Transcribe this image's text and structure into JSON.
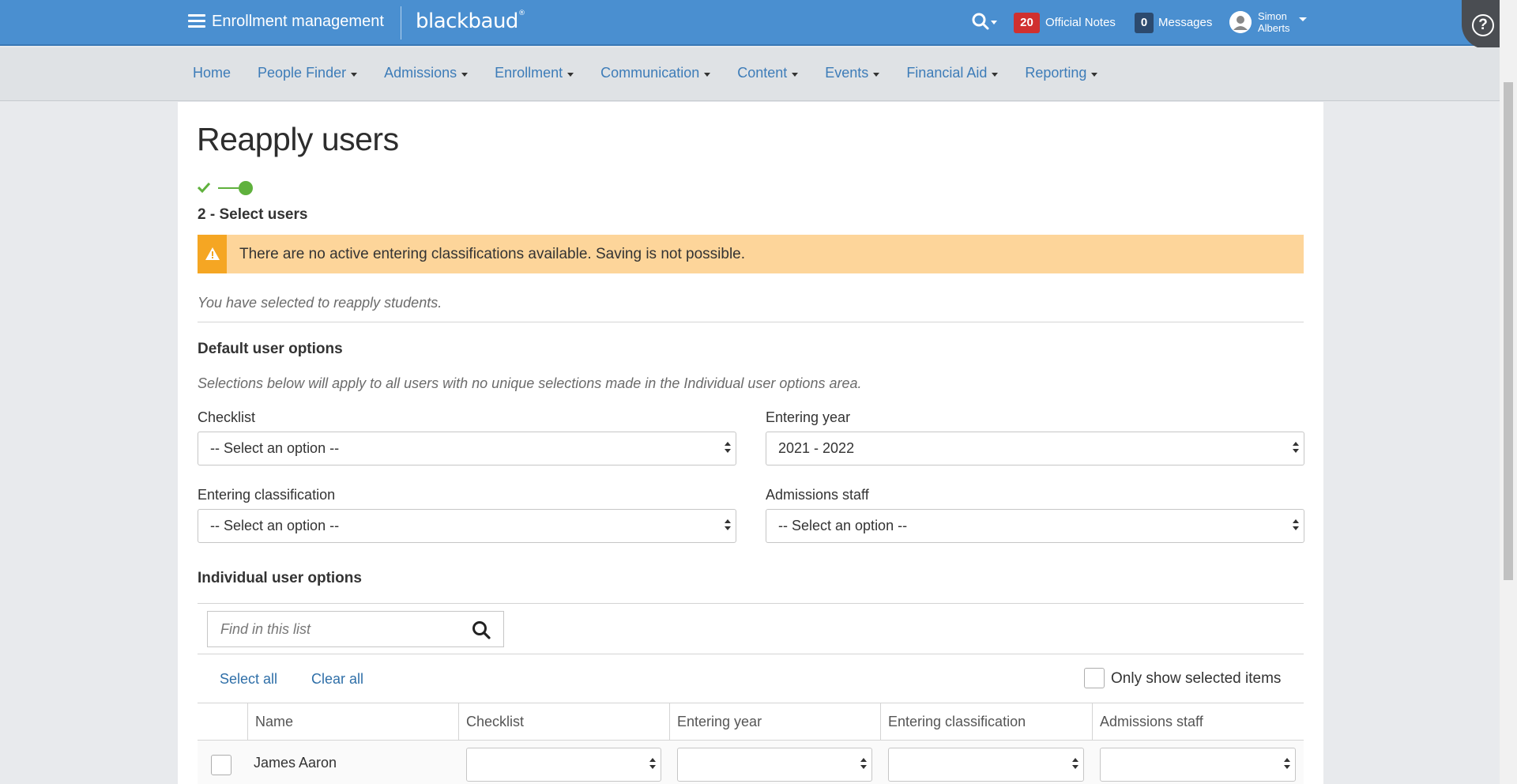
{
  "topbar": {
    "app_title": "Enrollment management",
    "brand": "blackbaud",
    "brand_mark": "®",
    "official_notes_count": "20",
    "official_notes_label": "Official Notes",
    "messages_count": "0",
    "messages_label": "Messages",
    "user_first": "Simon",
    "user_last": "Alberts",
    "help_label": "?"
  },
  "nav": {
    "items": [
      {
        "label": "Home",
        "dropdown": false
      },
      {
        "label": "People Finder",
        "dropdown": true
      },
      {
        "label": "Admissions",
        "dropdown": true
      },
      {
        "label": "Enrollment",
        "dropdown": true
      },
      {
        "label": "Communication",
        "dropdown": true
      },
      {
        "label": "Content",
        "dropdown": true
      },
      {
        "label": "Events",
        "dropdown": true
      },
      {
        "label": "Financial Aid",
        "dropdown": true
      },
      {
        "label": "Reporting",
        "dropdown": true
      }
    ]
  },
  "page": {
    "title": "Reapply users",
    "step_label": "2 - Select users",
    "alert_text": "There are no active entering classifications available. Saving is not possible.",
    "intro": "You have selected to reapply students.",
    "default_title": "Default user options",
    "default_desc": "Selections below will apply to all users with no unique selections made in the Individual user options area.",
    "fields": {
      "checklist_label": "Checklist",
      "checklist_value": "-- Select an option --",
      "entering_year_label": "Entering year",
      "entering_year_value": "2021 - 2022",
      "entering_class_label": "Entering classification",
      "entering_class_value": "-- Select an option --",
      "admissions_staff_label": "Admissions staff",
      "admissions_staff_value": "-- Select an option --"
    },
    "individual_title": "Individual user options",
    "search_placeholder": "Find in this list",
    "select_all": "Select all",
    "clear_all": "Clear all",
    "only_selected_label": "Only show selected items",
    "table": {
      "columns": [
        "Name",
        "Checklist",
        "Entering year",
        "Entering classification",
        "Admissions staff"
      ],
      "rows": [
        {
          "name": "James Aaron",
          "checklist": "",
          "entering_year": "",
          "entering_classification": "",
          "admissions_staff": ""
        }
      ]
    }
  },
  "colors": {
    "topbar": "#4a8fd0",
    "alert_bg": "#fdd59a",
    "alert_icon": "#f5a623",
    "notes_badge": "#d0302f",
    "messages_badge": "#2c4a6e",
    "link": "#3d7cb8",
    "step_green": "#5fb13d"
  }
}
